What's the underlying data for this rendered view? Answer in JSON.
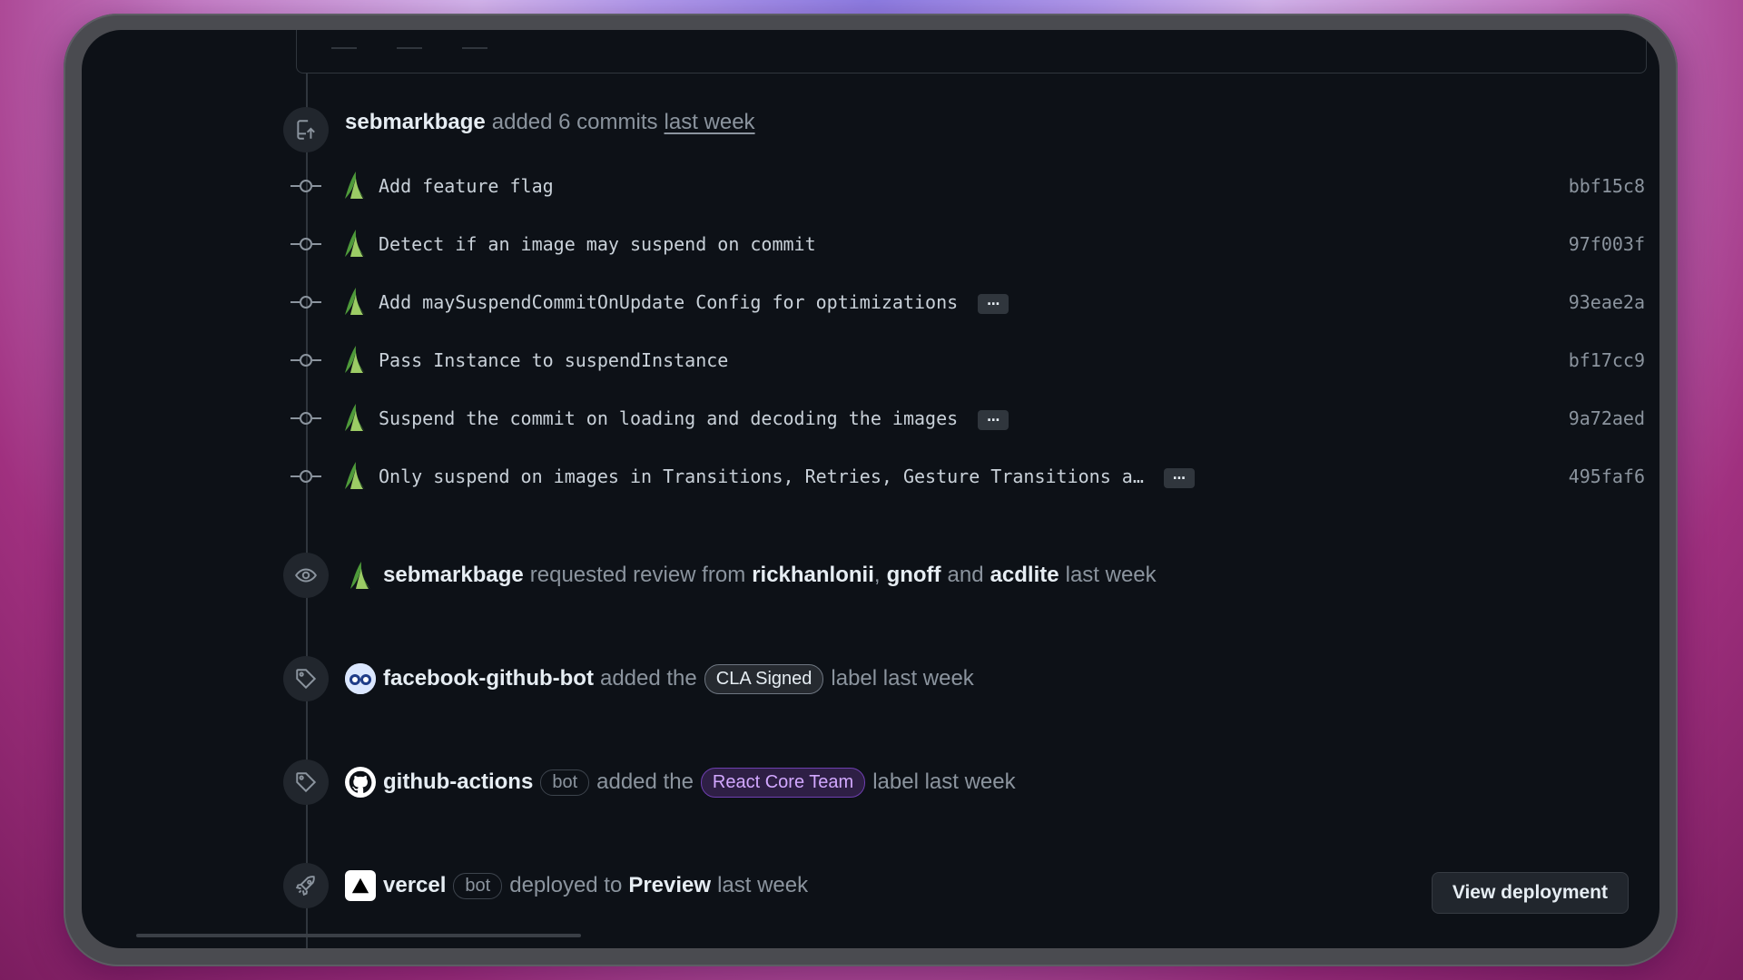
{
  "header_event": {
    "user": "sebmarkbage",
    "action": "added 6 commits",
    "when": "last week"
  },
  "commits": [
    {
      "message": "Add feature flag",
      "sha": "bbf15c8",
      "has_more": false
    },
    {
      "message": "Detect if an image may suspend on commit",
      "sha": "97f003f",
      "has_more": false
    },
    {
      "message": "Add maySuspendCommitOnUpdate Config for optimizations",
      "sha": "93eae2a",
      "has_more": true
    },
    {
      "message": "Pass Instance to suspendInstance",
      "sha": "bf17cc9",
      "has_more": false
    },
    {
      "message": "Suspend the commit on loading and decoding the images",
      "sha": "9a72aed",
      "has_more": true
    },
    {
      "message": "Only suspend on images in Transitions, Retries, Gesture Transitions a…",
      "sha": "495faf6",
      "has_more": true
    }
  ],
  "ellipsis_label": "…",
  "review_event": {
    "user": "sebmarkbage",
    "text": "requested review from",
    "reviewer1": "rickhanlonii",
    "comma": ",",
    "reviewer2": "gnoff",
    "and": "and",
    "reviewer3": "acdlite",
    "when": "last week"
  },
  "label_event_1": {
    "user": "facebook-github-bot",
    "text": "added the",
    "label": "CLA Signed",
    "suffix": "label last week"
  },
  "label_event_2": {
    "user": "github-actions",
    "bot": "bot",
    "text": "added the",
    "label": "React Core Team",
    "suffix": "label last week"
  },
  "deploy_event": {
    "user": "vercel",
    "bot": "bot",
    "text": "deployed to",
    "env": "Preview",
    "when": "last week",
    "button": "View deployment"
  },
  "colors": {
    "background": "#0d1117",
    "muted_text": "#8b949e",
    "strong_text": "#e6edf3",
    "react_label": "#d2a8ff"
  },
  "icons": [
    "push-icon",
    "commit-node-icon",
    "eye-icon",
    "tag-icon",
    "rocket-icon",
    "github-mark-icon",
    "vercel-triangle-icon"
  ]
}
